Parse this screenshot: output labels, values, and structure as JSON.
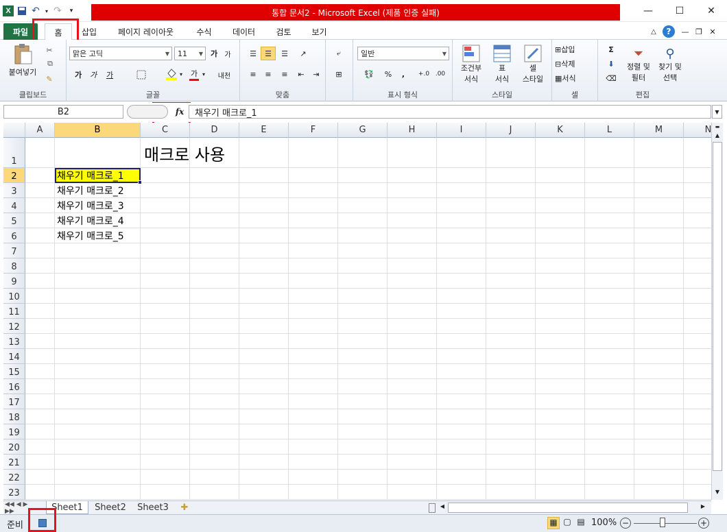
{
  "window": {
    "title": "통합 문서2 - Microsoft Excel (제품 인증 실패)",
    "app_icon": "X",
    "minimize": "—",
    "maximize": "☐",
    "close": "✕"
  },
  "ribbon_tabs": {
    "file": "파일",
    "home": "홈",
    "insert": "삽입",
    "page_layout": "페이지 레이아웃",
    "formulas": "수식",
    "data": "데이터",
    "review": "검토",
    "view": "보기"
  },
  "clipboard": {
    "paste": "붙여넣기",
    "label": "클립보드"
  },
  "font": {
    "name": "맑은 고딕",
    "size": "11",
    "grow": "가",
    "shrink": "가",
    "bold": "가",
    "italic": "가",
    "underline": "가",
    "fill_color": "#ffff00",
    "font_color_label": "가",
    "font_color": "#ff0000",
    "phonetic": "내천",
    "label": "글꼴"
  },
  "alignment": {
    "label": "맞춤"
  },
  "number": {
    "format": "일반",
    "percent": "%",
    "comma": ",",
    "label": "표시 형식"
  },
  "styles": {
    "conditional": [
      "조건부",
      "서식"
    ],
    "table": [
      "표",
      "서식"
    ],
    "cell": [
      "셀",
      "스타일"
    ],
    "label": "스타일"
  },
  "cells": {
    "insert": "삽입",
    "delete": "삭제",
    "format": "서식",
    "label": "셀"
  },
  "editing": {
    "sum": "Σ",
    "sort": [
      "정렬 및",
      "필터"
    ],
    "find": [
      "찾기 및",
      "선택"
    ],
    "label": "편집"
  },
  "formula_bar": {
    "name_box": "B2",
    "fx": "fx",
    "content": "채우기 매크로_1"
  },
  "sheet": {
    "columns": [
      "A",
      "B",
      "C",
      "D",
      "E",
      "F",
      "G",
      "H",
      "I",
      "J",
      "K",
      "L",
      "M",
      "N"
    ],
    "rows": [
      "1",
      "2",
      "3",
      "4",
      "5",
      "6",
      "7",
      "8",
      "9",
      "10",
      "11",
      "12",
      "13",
      "14",
      "15",
      "16",
      "17",
      "18",
      "19",
      "20",
      "21",
      "22",
      "23"
    ],
    "title_cell": "매크로 사용",
    "b_cells": [
      "채우기 매크로_1",
      "채우기 매크로_2",
      "채우기 매크로_3",
      "채우기 매크로_4",
      "채우기 매크로_5"
    ],
    "selected_fill": "#ffff00"
  },
  "sheet_tabs": [
    "Sheet1",
    "Sheet2",
    "Sheet3"
  ],
  "status": {
    "ready": "준비",
    "zoom": "100%"
  }
}
